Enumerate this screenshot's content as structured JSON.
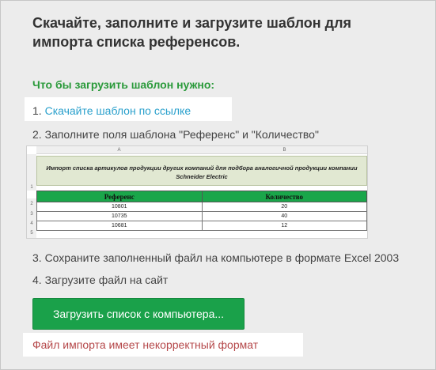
{
  "header": {
    "title": "Скачайте, заполните и загрузите шаблон для импорта списка референсов."
  },
  "instructions": {
    "subtitle": "Что бы загрузить шаблон нужно:",
    "step1_prefix": "1. ",
    "step1_link": "Скачайте шаблон по ссылке",
    "step2": "2. Заполните поля шаблона \"Референс\" и \"Количество\"",
    "step3": "3. Сохраните заполненный файл на компьютере в формате Excel 2003",
    "step4": "4. Загрузите файл на сайт"
  },
  "template_preview": {
    "col_a": "A",
    "col_b": "B",
    "row_numbers": [
      "1",
      "2",
      "3",
      "4",
      "5"
    ],
    "caption": "Импорт списка артикулов продукции других компаний для подбора аналогичной продукции компании Schneider Electric",
    "headers": [
      "Референс",
      "Количество"
    ],
    "rows": [
      [
        "10801",
        "20"
      ],
      [
        "10735",
        "40"
      ],
      [
        "10681",
        "12"
      ]
    ]
  },
  "actions": {
    "upload_label": "Загрузить список с компьютера..."
  },
  "status": {
    "error": "Файл импорта имеет некорректный формат"
  },
  "colors": {
    "accent_green": "#1aa14a",
    "link_blue": "#2aa0cc",
    "error_red": "#b5484a",
    "subtitle_green": "#2a9a3a"
  }
}
